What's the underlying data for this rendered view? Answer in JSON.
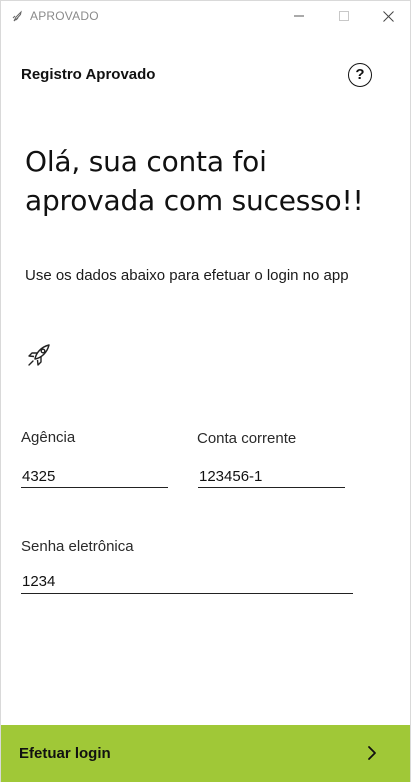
{
  "window": {
    "title": "APROVADO",
    "controls": [
      "minimize-icon",
      "maximize-icon",
      "close-icon"
    ]
  },
  "header": {
    "title": "Registro Aprovado",
    "help_label": "?"
  },
  "main": {
    "greeting": "Olá, sua conta foi aprovada com sucesso!!",
    "instructions": "Use os dados abaixo para efetuar o login no app",
    "icon": "rocket-icon",
    "fields": {
      "agencia": {
        "label": "Agência",
        "value": "4325"
      },
      "conta": {
        "label": "Conta corrente",
        "value": "123456-1"
      },
      "senha": {
        "label": "Senha eletrônica",
        "value": "1234"
      }
    }
  },
  "footer": {
    "login_label": "Efetuar login",
    "icon": "chevron-right-icon"
  },
  "colors": {
    "accent": "#a0c837",
    "text": "#111111",
    "title_bar_text": "#8a8a8a"
  }
}
